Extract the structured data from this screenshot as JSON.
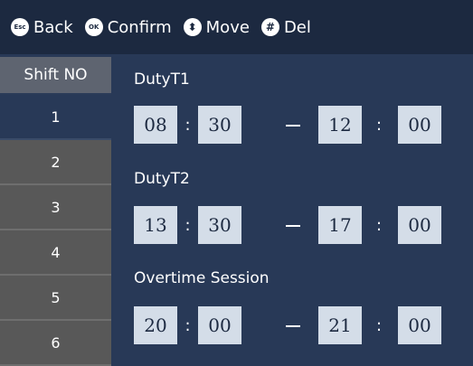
{
  "topbar": {
    "hints": [
      {
        "icon_text": "Esc",
        "icon": "esc-key-icon",
        "label": "Back"
      },
      {
        "icon_text": "OK",
        "icon": "ok-key-icon",
        "label": "Confirm"
      },
      {
        "icon_text": "⬍",
        "icon": "up-down-arrow-icon",
        "label": "Move"
      },
      {
        "icon_text": "#",
        "icon": "hash-key-icon",
        "label": "Del"
      }
    ]
  },
  "sidebar": {
    "header": "Shift NO",
    "items": [
      "1",
      "2",
      "3",
      "4",
      "5",
      "6"
    ],
    "active_index": 0
  },
  "sections": [
    {
      "label": "DutyT1",
      "start_hour": "08",
      "start_min": "30",
      "end_hour": "12",
      "end_min": "00"
    },
    {
      "label": "DutyT2",
      "start_hour": "13",
      "start_min": "30",
      "end_hour": "17",
      "end_min": "00"
    },
    {
      "label": "Overtime Session",
      "start_hour": "20",
      "start_min": "00",
      "end_hour": "21",
      "end_min": "00"
    }
  ],
  "separators": {
    "colon": ":"
  },
  "colors": {
    "background": "#283957",
    "topbar": "#1c2940",
    "time_box": "#d4dde8",
    "inactive_tab": "#585858"
  }
}
